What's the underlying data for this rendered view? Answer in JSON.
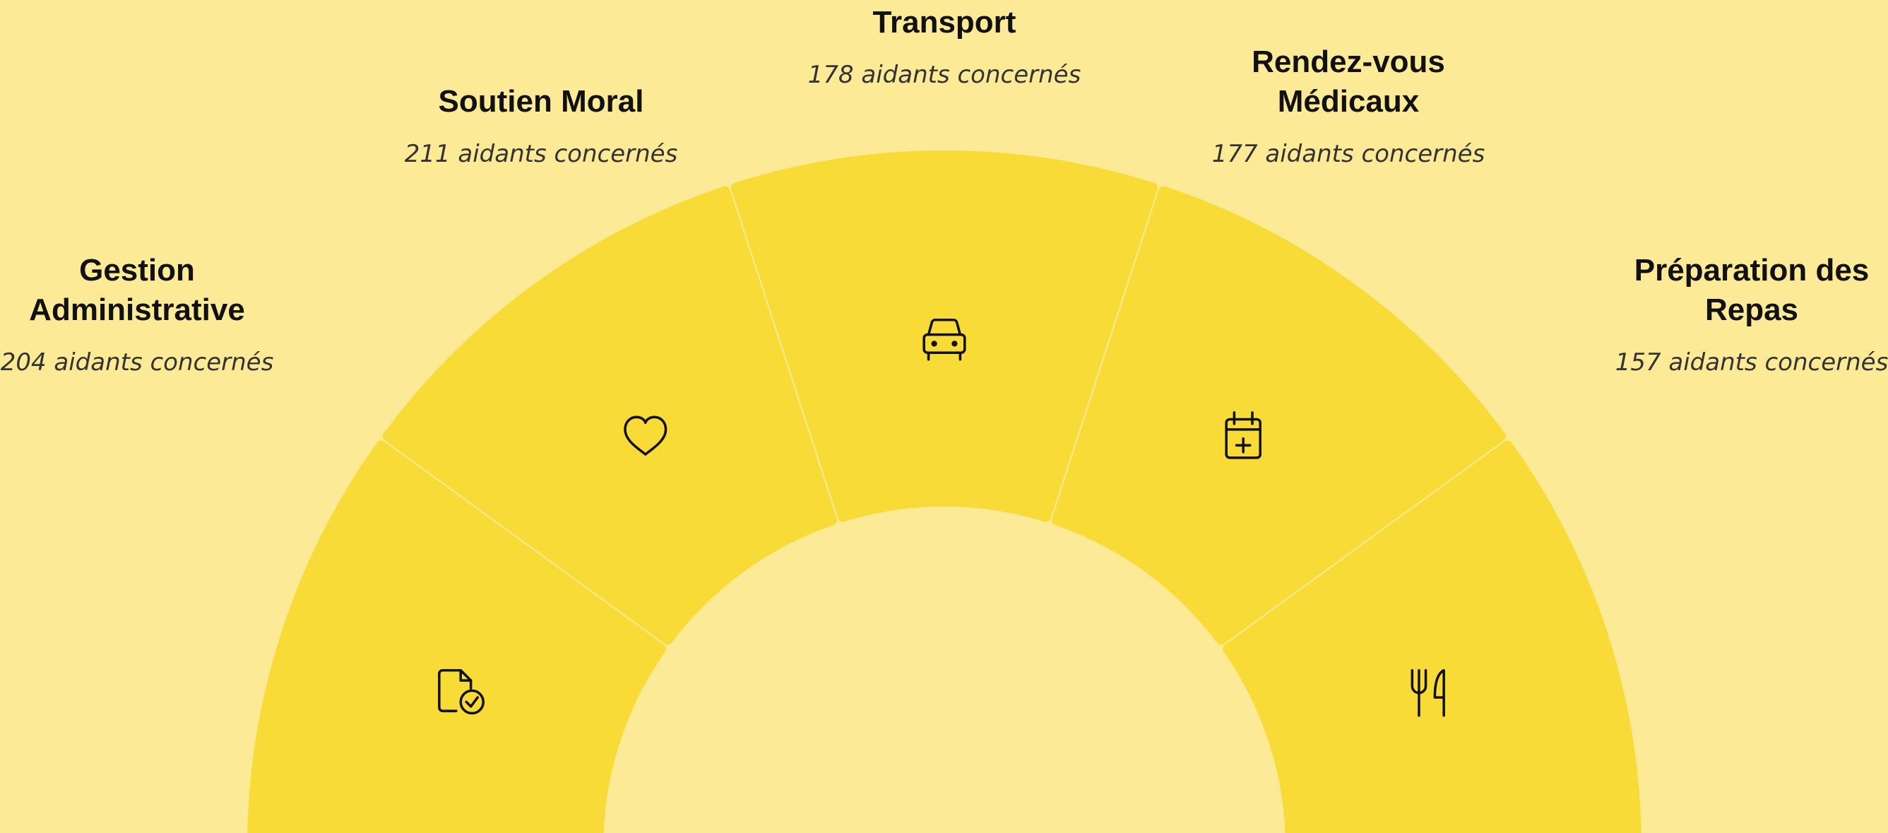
{
  "colors": {
    "background": "#fcea96",
    "segment_fill": "#f8db36",
    "icon_stroke": "#111111"
  },
  "segments": [
    {
      "id": "gestion",
      "title": "Gestion\nAdministrative",
      "count": "204 aidants concernés",
      "icon": "document-check-icon"
    },
    {
      "id": "soutien",
      "title": "Soutien Moral",
      "count": "211 aidants concernés",
      "icon": "heart-icon"
    },
    {
      "id": "transport",
      "title": "Transport",
      "count": "178 aidants concernés",
      "icon": "car-icon"
    },
    {
      "id": "rdv",
      "title": "Rendez-vous\nMédicaux",
      "count": "177 aidants concernés",
      "icon": "calendar-plus-icon"
    },
    {
      "id": "repas",
      "title": "Préparation des\nRepas",
      "count": "157 aidants concernés",
      "icon": "fork-knife-icon"
    }
  ]
}
